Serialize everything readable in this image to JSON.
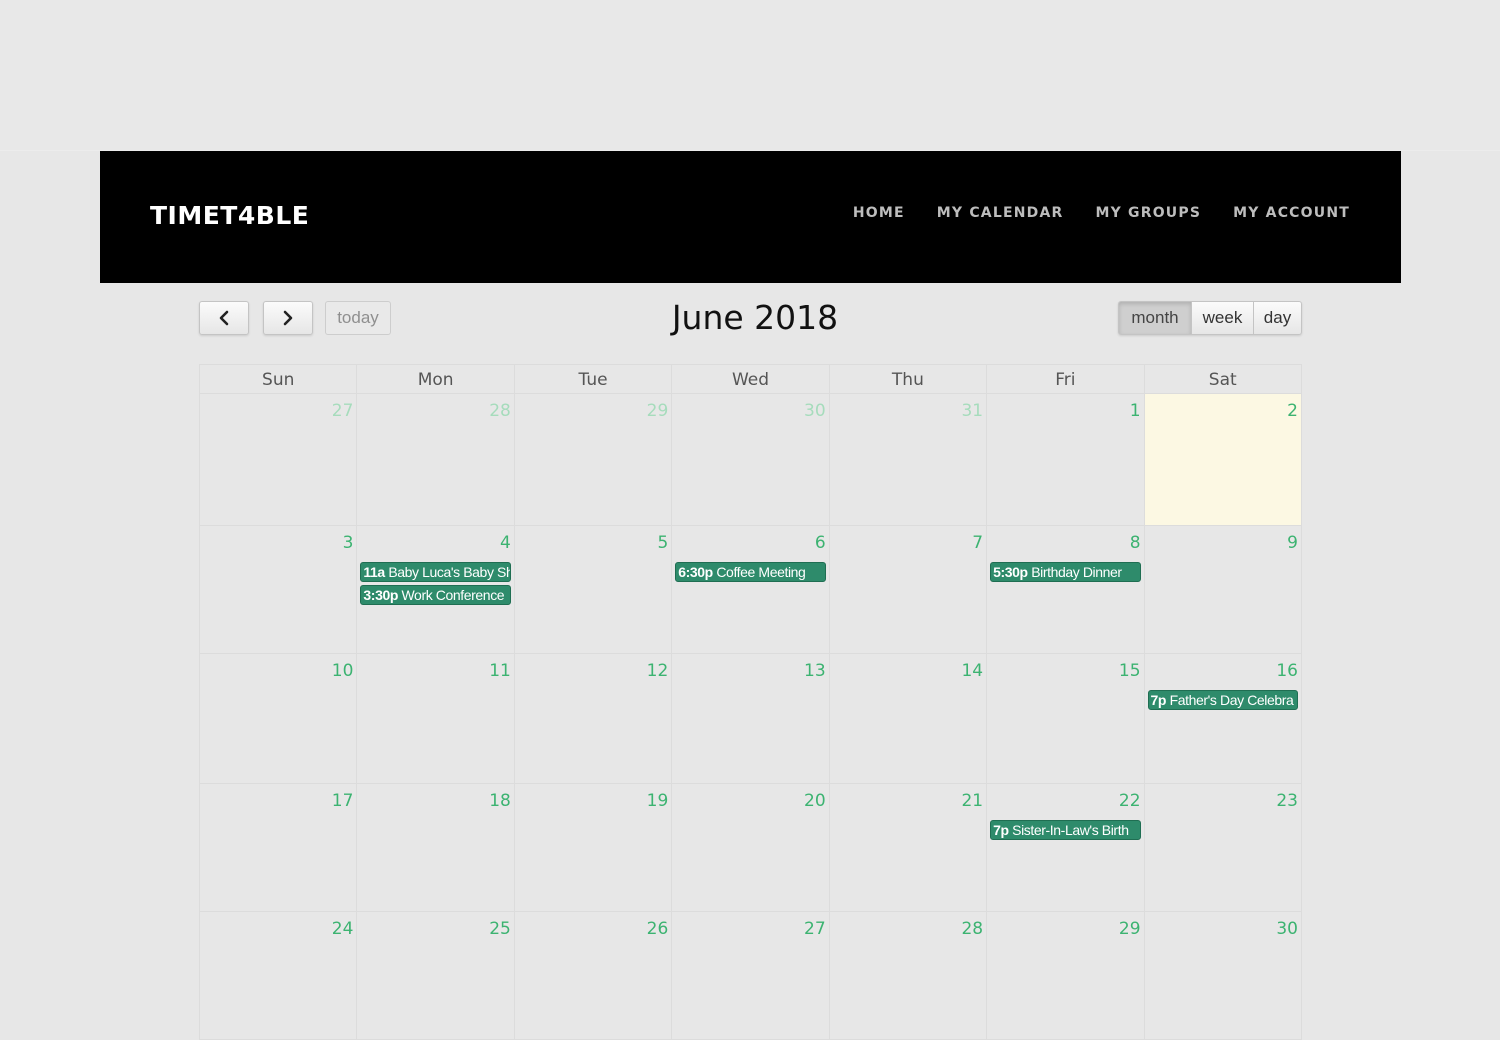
{
  "brand": "TIMET4BLE",
  "nav": [
    "HOME",
    "MY CALENDAR",
    "MY GROUPS",
    "MY ACCOUNT"
  ],
  "toolbar": {
    "prev_icon": "chevron-left-icon",
    "next_icon": "chevron-right-icon",
    "today": "today",
    "title": "June 2018",
    "views": [
      "month",
      "week",
      "day"
    ],
    "active_view": "month"
  },
  "day_headers": [
    "Sun",
    "Mon",
    "Tue",
    "Wed",
    "Thu",
    "Fri",
    "Sat"
  ],
  "colors": {
    "event_bg": "#2e8b6b",
    "day_number": "#3cb371",
    "today_bg": "#fcf8e3"
  },
  "weeks": [
    {
      "days": [
        {
          "num": "27",
          "other": true,
          "events": []
        },
        {
          "num": "28",
          "other": true,
          "events": []
        },
        {
          "num": "29",
          "other": true,
          "events": []
        },
        {
          "num": "30",
          "other": true,
          "events": []
        },
        {
          "num": "31",
          "other": true,
          "events": []
        },
        {
          "num": "1",
          "events": []
        },
        {
          "num": "2",
          "today": true,
          "events": []
        }
      ]
    },
    {
      "days": [
        {
          "num": "3",
          "events": []
        },
        {
          "num": "4",
          "events": [
            {
              "time": "11a",
              "title": "Baby Luca's Baby Sh"
            },
            {
              "time": "3:30p",
              "title": "Work Conference"
            }
          ]
        },
        {
          "num": "5",
          "events": []
        },
        {
          "num": "6",
          "events": [
            {
              "time": "6:30p",
              "title": "Coffee Meeting"
            }
          ]
        },
        {
          "num": "7",
          "events": []
        },
        {
          "num": "8",
          "events": [
            {
              "time": "5:30p",
              "title": "Birthday Dinner"
            }
          ]
        },
        {
          "num": "9",
          "events": []
        }
      ]
    },
    {
      "days": [
        {
          "num": "10",
          "events": []
        },
        {
          "num": "11",
          "events": []
        },
        {
          "num": "12",
          "events": []
        },
        {
          "num": "13",
          "events": []
        },
        {
          "num": "14",
          "events": []
        },
        {
          "num": "15",
          "events": []
        },
        {
          "num": "16",
          "events": [
            {
              "time": "7p",
              "title": "Father's Day Celebra"
            }
          ]
        }
      ]
    },
    {
      "days": [
        {
          "num": "17",
          "events": []
        },
        {
          "num": "18",
          "events": []
        },
        {
          "num": "19",
          "events": []
        },
        {
          "num": "20",
          "events": []
        },
        {
          "num": "21",
          "events": []
        },
        {
          "num": "22",
          "events": [
            {
              "time": "7p",
              "title": "Sister-In-Law's Birth"
            }
          ]
        },
        {
          "num": "23",
          "events": []
        }
      ]
    },
    {
      "days": [
        {
          "num": "24",
          "events": []
        },
        {
          "num": "25",
          "events": []
        },
        {
          "num": "26",
          "events": []
        },
        {
          "num": "27",
          "events": []
        },
        {
          "num": "28",
          "events": []
        },
        {
          "num": "29",
          "events": []
        },
        {
          "num": "30",
          "events": []
        }
      ]
    }
  ]
}
